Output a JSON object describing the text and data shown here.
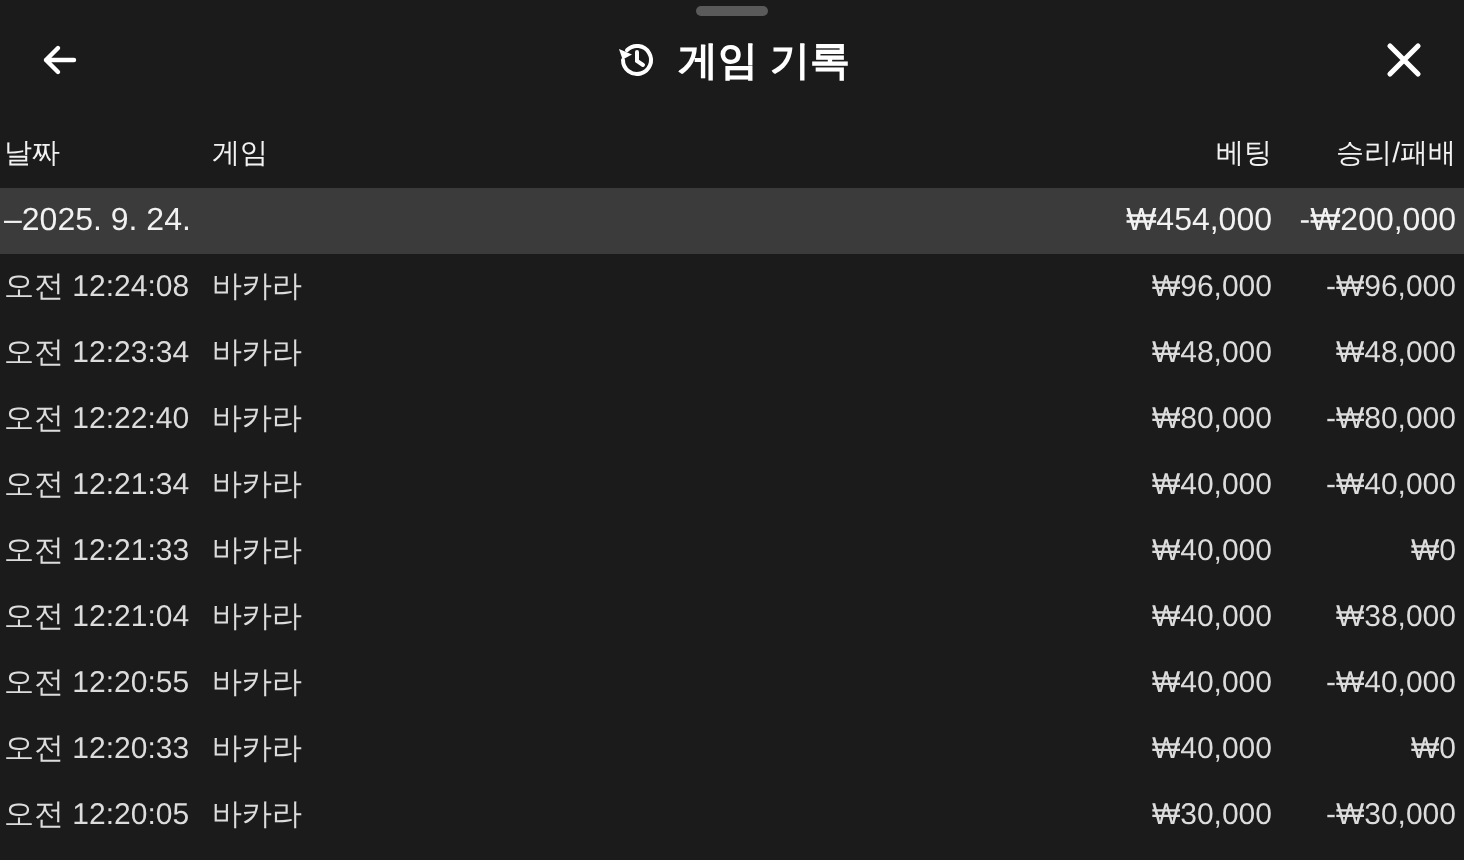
{
  "header": {
    "title": "게임 기록"
  },
  "table": {
    "columns": [
      "날짜",
      "게임",
      "베팅",
      "승리/패배"
    ],
    "groups": [
      {
        "date": "–2025. 9. 24.",
        "bet": "₩454,000",
        "result": "-₩200,000",
        "rows": [
          {
            "time": "오전 12:24:08",
            "game": "바카라",
            "bet": "₩96,000",
            "result": "-₩96,000"
          },
          {
            "time": "오전 12:23:34",
            "game": "바카라",
            "bet": "₩48,000",
            "result": "₩48,000"
          },
          {
            "time": "오전 12:22:40",
            "game": "바카라",
            "bet": "₩80,000",
            "result": "-₩80,000"
          },
          {
            "time": "오전 12:21:34",
            "game": "바카라",
            "bet": "₩40,000",
            "result": "-₩40,000"
          },
          {
            "time": "오전 12:21:33",
            "game": "바카라",
            "bet": "₩40,000",
            "result": "₩0"
          },
          {
            "time": "오전 12:21:04",
            "game": "바카라",
            "bet": "₩40,000",
            "result": "₩38,000"
          },
          {
            "time": "오전 12:20:55",
            "game": "바카라",
            "bet": "₩40,000",
            "result": "-₩40,000"
          },
          {
            "time": "오전 12:20:33",
            "game": "바카라",
            "bet": "₩40,000",
            "result": "₩0"
          },
          {
            "time": "오전 12:20:05",
            "game": "바카라",
            "bet": "₩30,000",
            "result": "-₩30,000"
          }
        ]
      }
    ]
  }
}
